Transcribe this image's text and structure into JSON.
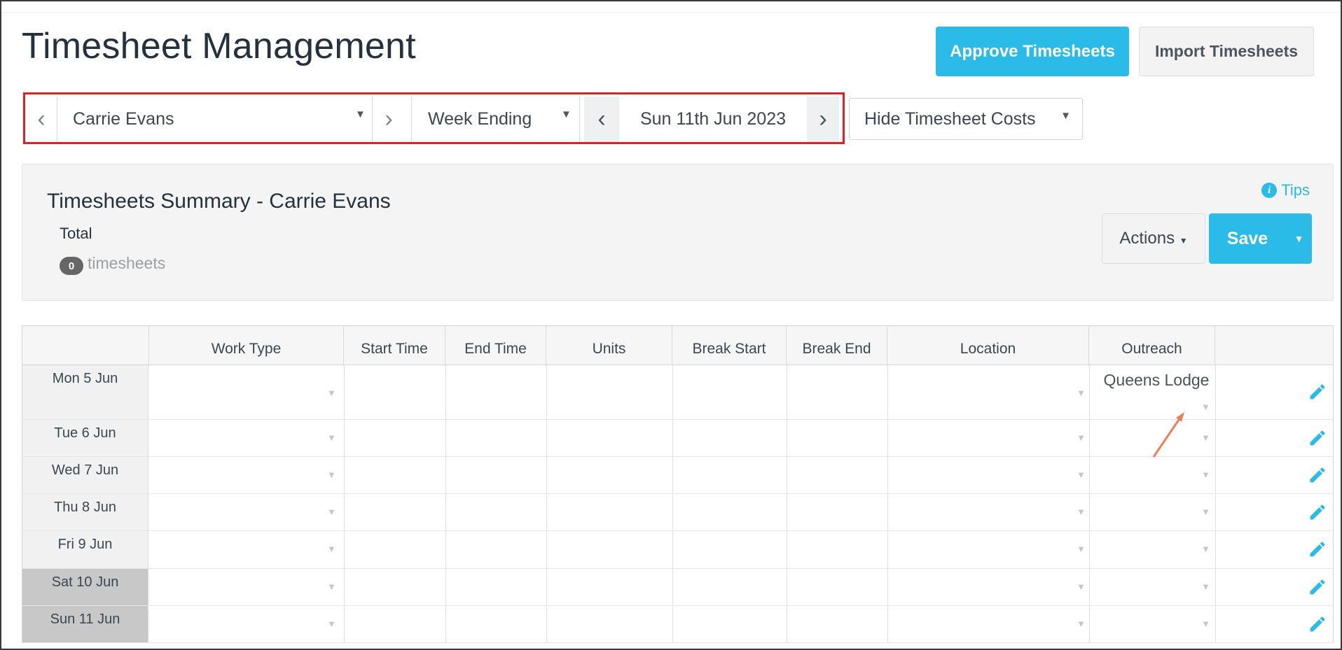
{
  "page": {
    "title": "Timesheet Management"
  },
  "header_buttons": {
    "approve": "Approve Timesheets",
    "import": "Import Timesheets"
  },
  "filters": {
    "employee": "Carrie Evans",
    "period_type": "Week Ending",
    "date": "Sun 11th Jun 2023",
    "costs_toggle": "Hide Timesheet Costs"
  },
  "summary": {
    "title": "Timesheets Summary - Carrie Evans",
    "total_label": "Total",
    "count": "0",
    "count_label": "timesheets",
    "tips": "Tips",
    "actions_label": "Actions",
    "save_label": "Save"
  },
  "grid": {
    "columns": [
      "Work Type",
      "Start Time",
      "End Time",
      "Units",
      "Break Start",
      "Break End",
      "Location",
      "Outreach"
    ],
    "rows": [
      {
        "day": "Mon 5 Jun",
        "outreach": "Queens Lodge",
        "weekend": false
      },
      {
        "day": "Tue 6 Jun",
        "outreach": "",
        "weekend": false
      },
      {
        "day": "Wed 7 Jun",
        "outreach": "",
        "weekend": false
      },
      {
        "day": "Thu 8 Jun",
        "outreach": "",
        "weekend": false
      },
      {
        "day": "Fri 9 Jun",
        "outreach": "",
        "weekend": false
      },
      {
        "day": "Sat 10 Jun",
        "outreach": "",
        "weekend": true
      },
      {
        "day": "Sun 11 Jun",
        "outreach": "",
        "weekend": true
      }
    ]
  },
  "icons": {
    "prev": "chevron-left-icon",
    "next": "chevron-right-icon",
    "dropdown": "caret-down-icon",
    "info": "info-icon",
    "edit": "pencil-icon"
  },
  "colors": {
    "accent": "#2bbbe8",
    "highlight_border": "#e31e24",
    "annotation_arrow": "#e8805a"
  }
}
